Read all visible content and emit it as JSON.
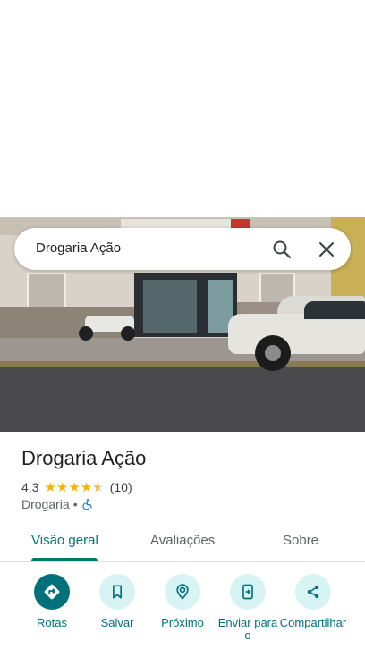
{
  "search": {
    "value": "Drogaria Ação"
  },
  "place": {
    "name": "Drogaria Ação",
    "rating": "4,3",
    "stars": 4.3,
    "review_count": "(10)",
    "category": "Drogaria",
    "separator": "•"
  },
  "tabs": [
    {
      "label": "Visão geral",
      "active": true
    },
    {
      "label": "Avaliações",
      "active": false
    },
    {
      "label": "Sobre",
      "active": false
    }
  ],
  "actions": [
    {
      "label": "Rotas",
      "icon": "directions-icon"
    },
    {
      "label": "Salvar",
      "icon": "bookmark-icon"
    },
    {
      "label": "Próximo",
      "icon": "nearby-icon"
    },
    {
      "label": "Enviar para o",
      "icon": "send-to-phone-icon"
    },
    {
      "label": "Compartilhar",
      "icon": "share-icon"
    }
  ],
  "colors": {
    "accent": "#00796b",
    "action_bg": "#d7f3f4",
    "star": "#f5b400"
  }
}
